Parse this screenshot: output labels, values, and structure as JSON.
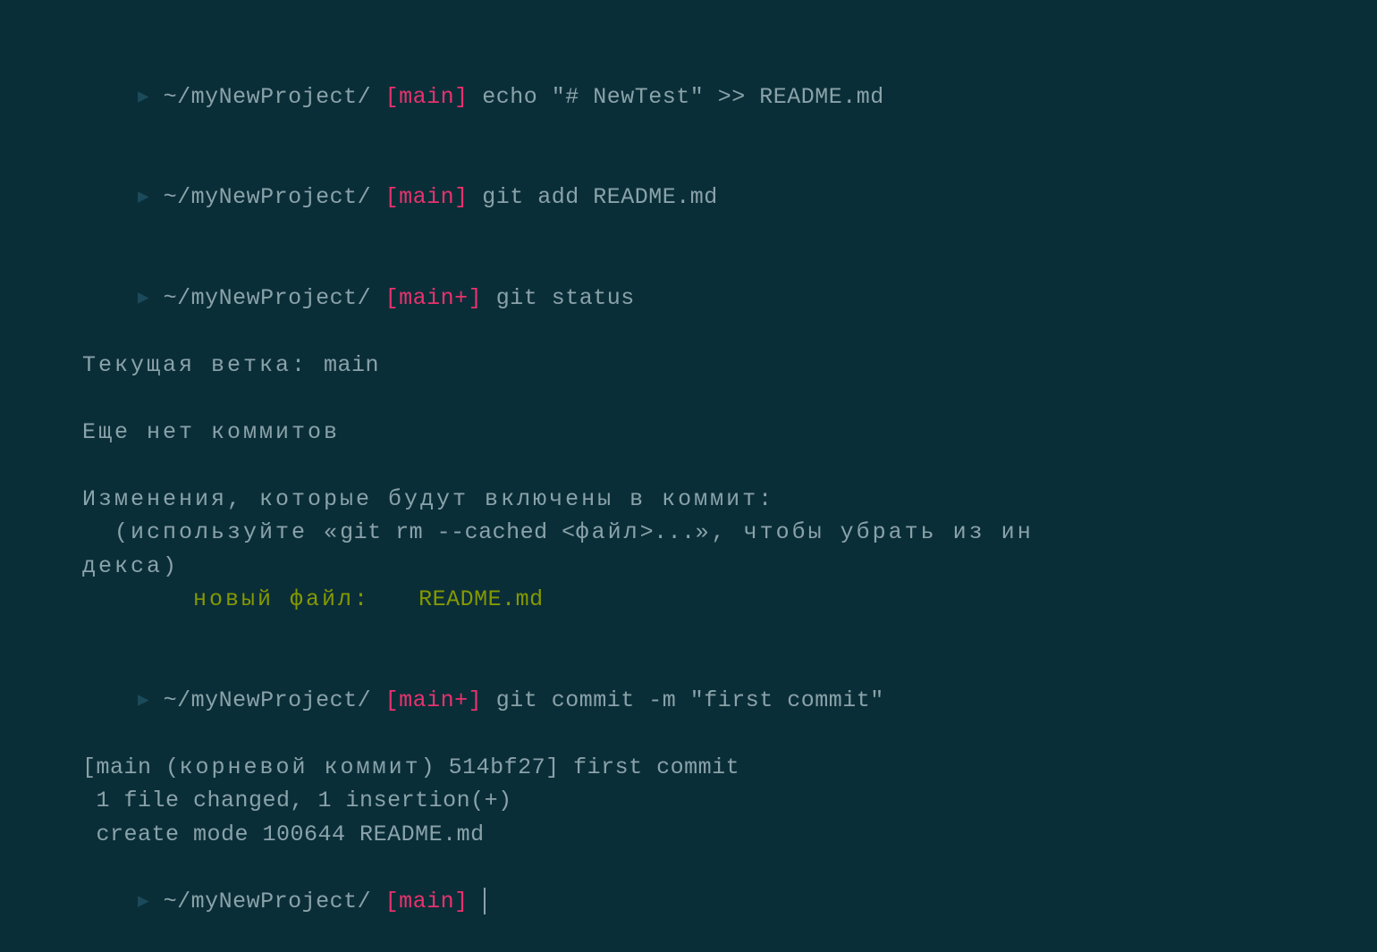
{
  "prompt": {
    "arrow": "▸",
    "apple": "",
    "cwd": "~/myNewProject/",
    "branch_main": "[main]",
    "branch_main_plus": "[main+]"
  },
  "lines": {
    "cmd1": "echo \"# NewTest\" >> README.md",
    "cmd2": "git add README.md",
    "cmd3": "git status",
    "out1": "Текущая ветка: ",
    "out1b": "main",
    "out2": "Еще нет коммитов",
    "out3": "Изменения, которые будут включены в коммит:",
    "out4a": "  (используйте «",
    "out4b": "git rm --cached <",
    "out4c": "файл",
    "out4d": ">...», чтобы убрать из ин",
    "out4e": "декса)",
    "out5a": "новый файл:   ",
    "out5b": "README.md",
    "cmd4": "git commit -m \"first commit\"",
    "out6a": "[main (",
    "out6b": "корневой коммит",
    "out6c": ") 514bf27] first commit",
    "out7": " 1 file changed, 1 insertion(+)",
    "out8": " create mode 100644 README.md"
  }
}
